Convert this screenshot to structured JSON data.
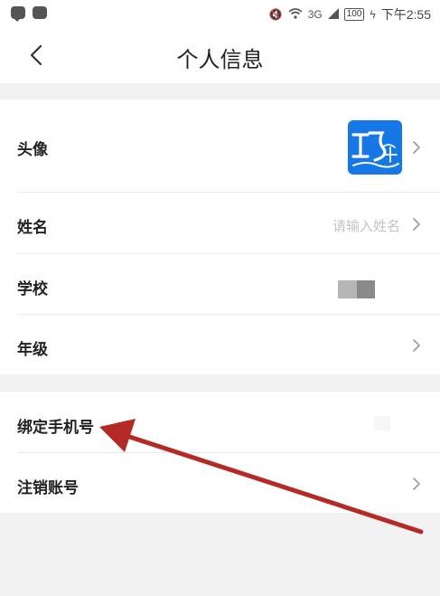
{
  "status_bar": {
    "network": "3G",
    "battery": "100",
    "time": "下午2:55"
  },
  "header": {
    "title": "个人信息"
  },
  "rows": {
    "avatar": {
      "label": "头像"
    },
    "name": {
      "label": "姓名",
      "placeholder": "请输入姓名"
    },
    "school": {
      "label": "学校"
    },
    "grade": {
      "label": "年级"
    },
    "bind_phone": {
      "label": "绑定手机号"
    },
    "cancel_account": {
      "label": "注销账号"
    }
  },
  "colors": {
    "avatar_bg": "#1677e6",
    "annotation_arrow": "#b52a25"
  }
}
